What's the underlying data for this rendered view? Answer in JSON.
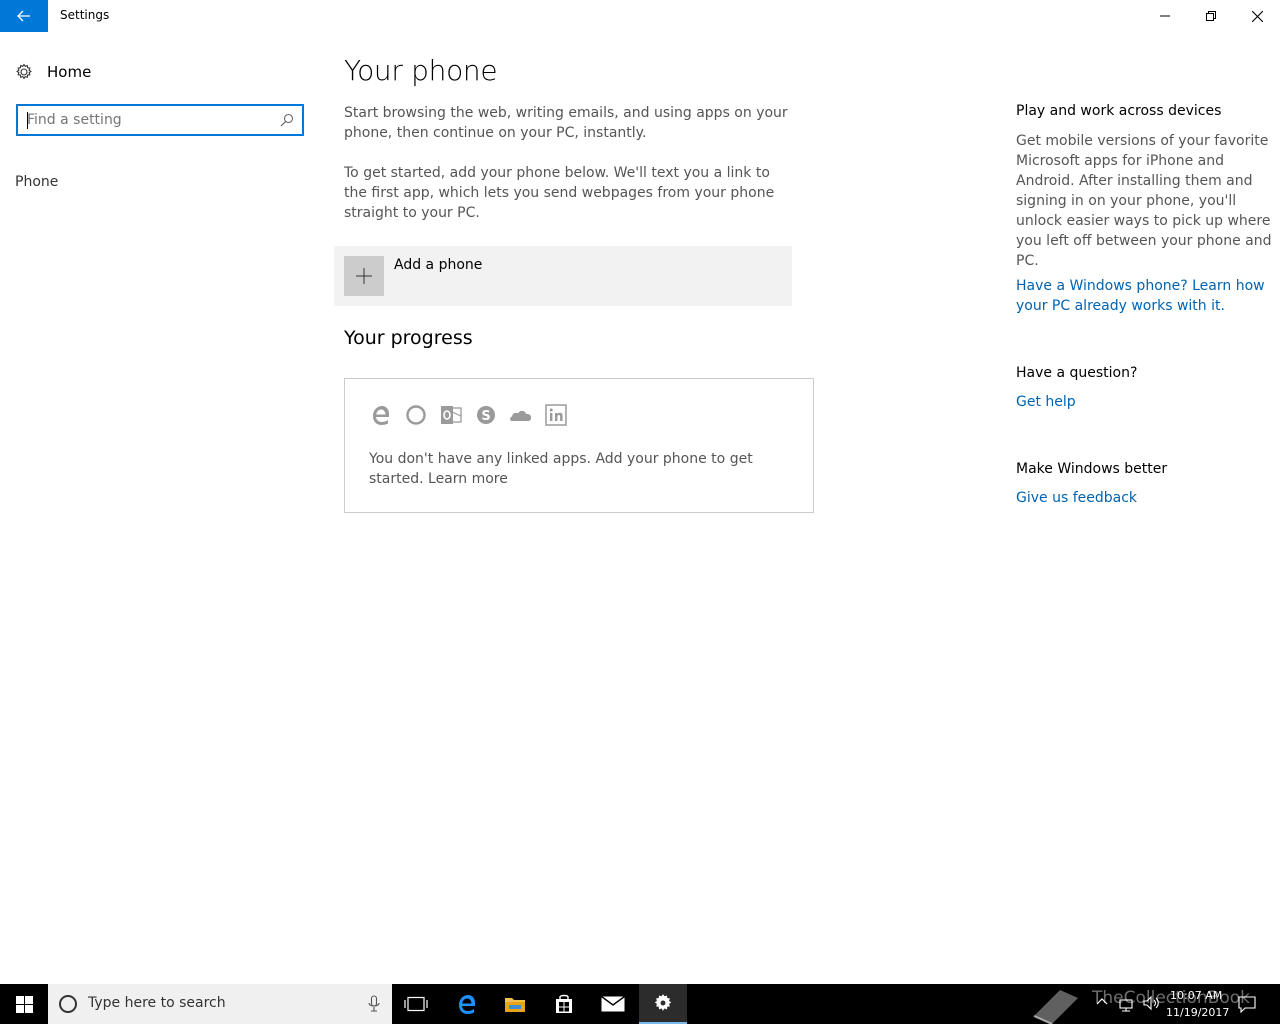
{
  "window": {
    "title": "Settings"
  },
  "sidebar": {
    "home_label": "Home",
    "search_placeholder": "Find a setting",
    "nav_phone": "Phone"
  },
  "main": {
    "title": "Your phone",
    "intro": "Start browsing the web, writing emails, and using apps on your phone, then continue on your PC, instantly.",
    "instructions": "To get started, add your phone below. We'll text you a link to the first app, which lets you send webpages from your phone straight to your PC.",
    "add_phone_label": "Add a phone",
    "progress_title": "Your progress",
    "progress_icons": [
      "edge-icon",
      "cortana-icon",
      "outlook-icon",
      "skype-icon",
      "onedrive-icon",
      "linkedin-icon"
    ],
    "progress_text": "You don't have any linked apps. Add your phone to get started.",
    "learn_more": "Learn more"
  },
  "right": {
    "section1_title": "Play and work across devices",
    "section1_body": "Get mobile versions of your favorite Microsoft apps for iPhone and Android. After installing them and signing in on your phone, you'll unlock easier ways to pick up where you left off between your phone and PC.",
    "section1_link": "Have a Windows phone? Learn how your PC already works with it.",
    "section2_title": "Have a question?",
    "section2_link": "Get help",
    "section3_title": "Make Windows better",
    "section3_link": "Give us feedback"
  },
  "taskbar": {
    "search_placeholder": "Type here to search",
    "time": "10:07 AM",
    "date": "11/19/2017",
    "watermark": "TheCollectionBook"
  },
  "colors": {
    "accent": "#0078d7",
    "link": "#0063b1",
    "taskbar": "#000000"
  }
}
